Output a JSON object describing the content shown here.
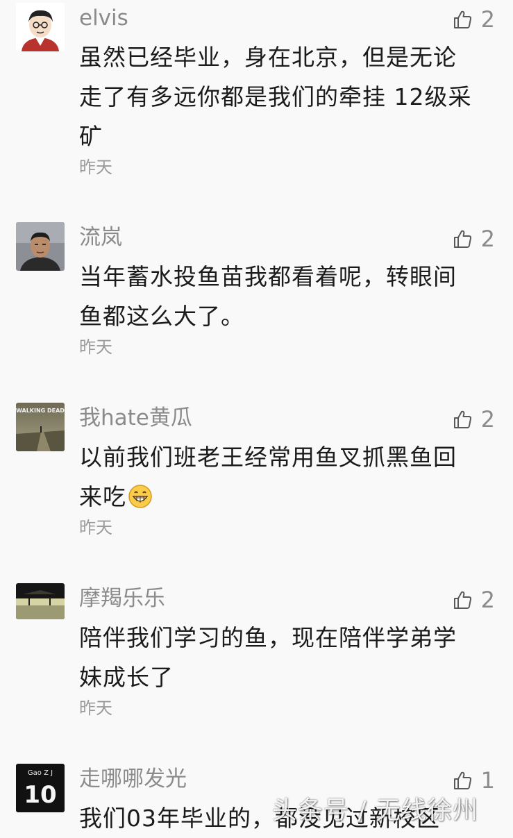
{
  "comments": [
    {
      "username": "elvis",
      "likes": "2",
      "lines": [
        "虽然已经毕业，身在北京，但是无论",
        "走了有多远你都是我们的牵挂 12级采",
        "矿"
      ],
      "time": "昨天",
      "avatar_icon": "cartoon-boy-avatar"
    },
    {
      "username": "流岚",
      "likes": "2",
      "lines": [
        "当年蓄水投鱼苗我都看着呢，转眼间",
        "鱼都这么大了。"
      ],
      "time": "昨天",
      "avatar_icon": "man-photo-avatar"
    },
    {
      "username": "我hate黄瓜",
      "likes": "2",
      "lines": [
        "以前我们班老王经常用鱼叉抓黑鱼回",
        "来吃"
      ],
      "time": "昨天",
      "avatar_icon": "walking-dead-avatar",
      "avatar_text": "WALKING DEAD"
    },
    {
      "username": "摩羯乐乐",
      "likes": "2",
      "lines": [
        "陪伴我们学习的鱼，现在陪伴学弟学",
        "妹成长了"
      ],
      "time": "昨天",
      "avatar_icon": "landscape-avatar"
    },
    {
      "username": "走哪哪发光",
      "likes": "1",
      "lines": [
        "我们03年毕业的，都没见过新校区"
      ],
      "time": "",
      "avatar_icon": "jersey-avatar",
      "avatar_text_top": "Gao Z  J",
      "avatar_text_num": "10"
    }
  ],
  "watermark": "头条号 / 无线徐州",
  "colors": {
    "background": "#f9f9f9",
    "name": "#8b8b8b",
    "text": "#1b1b1b",
    "time": "#9a9a9a"
  }
}
